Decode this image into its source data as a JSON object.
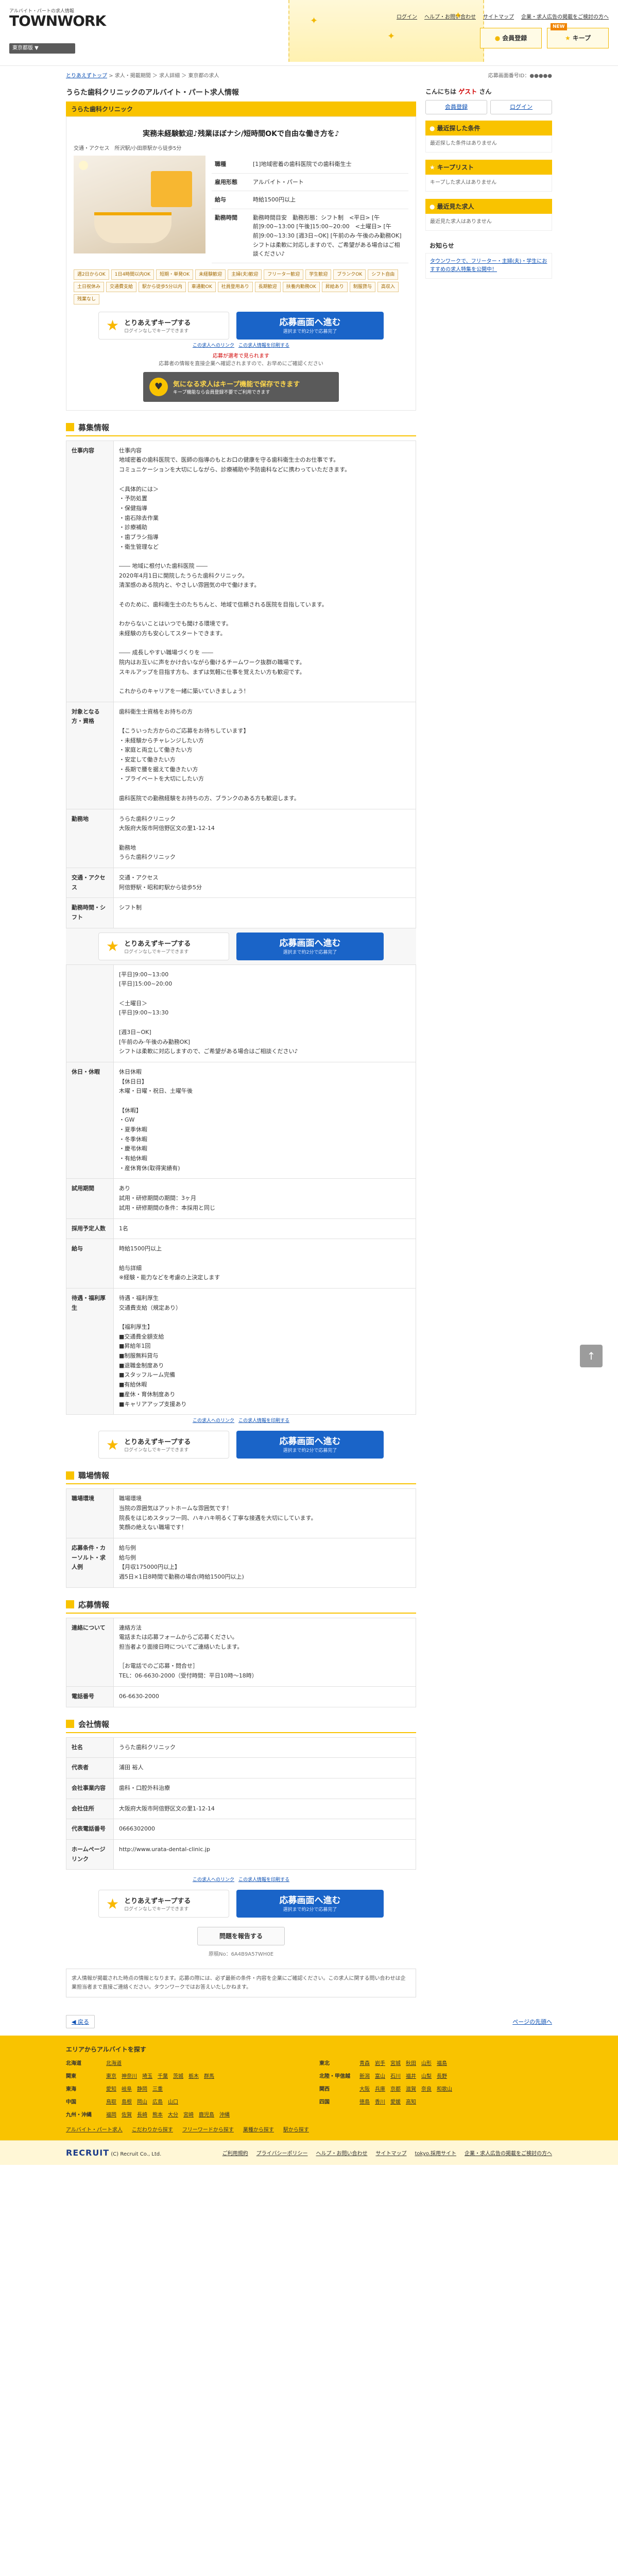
{
  "header": {
    "logo_small": "アルバイト・パートの求人情報",
    "logo_main": "TOWNWORK",
    "pref": "東京都版 ▼",
    "toplinks": [
      "ログイン",
      "ヘルプ・お問い合わせ",
      "サイトマップ",
      "企業・求人広告の掲載をご検討の方へ"
    ],
    "member_btn": "会員登録",
    "keep_btn": "キープ",
    "keep_tag": "NEW"
  },
  "breadcrumb": {
    "items": [
      "とりあえずトップ",
      "求人・掲載期間 ＞ 求人詳細 ＞ 東京都の求人"
    ],
    "right": "応募画面番号ID：●●●●●"
  },
  "job": {
    "company_title": "うらた歯科クリニックのアルバイト・パート求人情報",
    "company_bar": "うらた歯科クリニック",
    "catch": "実務未経験歓迎♪残業ほぼナシ/短時間OKで自由な働き方を♪",
    "tags_line": "交通・アクセス　所沢駅/小田原駅から徒歩5分",
    "info": [
      {
        "h": "職種",
        "v": "[1]地域密着の歯科医院での歯科衛生士"
      },
      {
        "h": "雇用形態",
        "v": "アルバイト・パート"
      },
      {
        "h": "給与",
        "v": "時給1500円以上"
      },
      {
        "h": "勤務時間",
        "v": "勤務時間目安　勤務形態：シフト制　<平日> [午前]9:00~13:00 [午後]15:00~20:00　<土曜日> [午前]9:00~13:30 [週3日~OK] [午前のみ·午後のみ勤務OK] シフトは柔軟に対応しますので、ご希望がある場合はご相談ください♪"
      }
    ],
    "chips": [
      "週2日からOK",
      "1日4時間以内OK",
      "短期・単発OK",
      "未経験歓迎",
      "主婦(夫)歓迎",
      "フリーター歓迎",
      "学生歓迎",
      "ブランクOK",
      "シフト自由",
      "土日祝休み",
      "交通費支給",
      "駅から徒歩5分以内",
      "車通勤OK",
      "社員登用あり",
      "長期歓迎",
      "扶養内勤務OK",
      "昇給あり",
      "制服貸与",
      "高収入",
      "残業なし"
    ]
  },
  "cta": {
    "keep_t1": "とりあえずキープする",
    "keep_t2": "ログインなしでキープできます",
    "apply_t1": "応募画面へ進む",
    "apply_t2": "選択まで約2分で応募完了",
    "links": [
      "この求人へのリンク",
      "この求人情報を印刷する"
    ],
    "note1": "応募が選考で見られます",
    "note2": "応募者の情報を直接企業へ確認されますので、お早めにご確認ください",
    "banner_t1": "気になる求人はキープ機能で保存できます",
    "banner_t2": "キープ機能なら会員登録不要でご利用できます"
  },
  "section_recruit": "募集情報",
  "recruit": [
    {
      "h": "仕事内容",
      "v": "仕事内容\n地域密着の歯科医院で、医師の指導のもとお口の健康を守る歯科衛生士のお仕事です。\nコミュニケーションを大切にしながら、診療補助や予防歯科などに携わっていただきます。\n\n＜具体的には＞\n・予防処置\n・保健指導\n・歯石除去作業\n・診療補助\n・歯ブラシ指導\n・衛生管理など\n\n―― 地域に根付いた歯科医院 ――\n2020年4月1日に開院したうらた歯科クリニック。\n清潔感のある院内と、やさしい雰囲気の中で働けます。\n\nそのために、歯科衛生士のたちちんと、地域で信頼される医院を目指しています。\n\nわからないことはいつでも聞ける環境です。\n未経験の方も安心してスタートできます。\n\n―― 成長しやすい職場づくりを ――\n院内はお互いに声をかけ合いながら働けるチームワーク抜群の職場です。\nスキルアップを目指す方も、まずは気軽に仕事を覚えたい方も歓迎です。\n\nこれからのキャリアを一緒に築いていきましょう！"
    },
    {
      "h": "対象となる方・資格",
      "v": "歯科衛生士資格をお持ちの方\n\n【こういった方からのご応募をお待ちしています】\n・未経験からチャレンジしたい方\n・家庭と両立して働きたい方\n・安定して働きたい方\n・長期で腰を据えて働きたい方\n・プライベートを大切にしたい方\n\n歯科医院での勤務経験をお持ちの方、ブランクのある方も歓迎します。"
    },
    {
      "h": "勤務地",
      "v": "うらた歯科クリニック\n大阪府大阪市阿倍野区文の里1-12-14\n\n勤務地\nうらた歯科クリニック"
    },
    {
      "h": "交通・アクセス",
      "v": "交通・アクセス\n阿倍野駅・昭和町駅から徒歩5分"
    },
    {
      "h": "勤務時間・シフト",
      "v": "シフト制"
    }
  ],
  "recruit2": [
    {
      "h": "",
      "v": "[平日]9:00~13:00\n[平日]15:00~20:00\n\n＜土曜日＞\n[平日]9:00~13:30\n\n[週3日~OK]\n[午前のみ·午後のみ勤務OK]\nシフトは柔軟に対応しますので、ご希望がある場合はご相談ください♪"
    },
    {
      "h": "休日・休暇",
      "v": "休日休暇\n【休日日】\n木曜・日曜・祝日、土曜午後\n\n【休暇】\n・GW\n・夏季休暇\n・冬季休暇\n・慶弔休暇\n・有給休暇\n・産休育休(取得実績有)"
    },
    {
      "h": "試用期間",
      "v": "あり\n試用・研修期間の期間：3ヶ月\n試用・研修期間の条件：本採用と同じ"
    },
    {
      "h": "採用予定人数",
      "v": "1名"
    },
    {
      "h": "給与",
      "v": "時給1500円以上\n\n給与詳細\n※経験・能力などを考慮の上決定します"
    },
    {
      "h": "待遇・福利厚生",
      "v": "待遇・福利厚生\n交通費支給（規定あり）\n\n【福利厚生】\n■交通費全額支給\n■昇給年1回\n■制服無料貸与\n■退職金制度あり\n■スタッフルーム完備\n■有給休暇\n■産休・育休制度あり\n■キャリアアップ支援あり"
    }
  ],
  "section_workplace": "職場情報",
  "workplace": [
    {
      "h": "職場環境",
      "v": "職場環境\n当院の雰囲気はアットホームな雰囲気です！\n院長をはじめスタッフ一同、ハキハキ明るく丁寧な接遇を大切にしています。\n笑顔の絶えない職場です！"
    },
    {
      "h": "応募条件・カーソルト・求人例",
      "v": "給与例\n給与例\n【月収175000円以上】\n週5日×1日8時間で勤務の場合(時給1500円以上)"
    }
  ],
  "section_apply": "応募情報",
  "apply": [
    {
      "h": "連絡について",
      "v": "連絡方法\n電話または応募フォームからご応募ください。\n担当者より面接日時についてご連絡いたします。\n\n［お電話でのご応募・問合せ］\nTEL：06-6630-2000（受付時間：平日10時～18時）"
    },
    {
      "h": "電話番号",
      "v": "06-6630-2000"
    }
  ],
  "section_company": "会社情報",
  "company": [
    {
      "h": "社名",
      "v": "うらた歯科クリニック"
    },
    {
      "h": "代表者",
      "v": "浦田 裕人"
    },
    {
      "h": "会社事業内容",
      "v": "歯科・口腔外科治療"
    },
    {
      "h": "会社住所",
      "v": "大阪府大阪市阿倍野区文の里1-12-14"
    },
    {
      "h": "代表電話番号",
      "v": "0666302000"
    },
    {
      "h": "ホームページリンク",
      "v": "http://www.urata-dental-clinic.jp"
    }
  ],
  "footer_main": {
    "print": "問題を報告する",
    "job_no": "原稿No：6A4B9A57WH0E",
    "notice": "求人情報が掲載された時点の情報となります。応募の際には、必ず最新の条件・内容を企業にご確認ください。この求人に関する問い合わせは企業担当者まで直接ご連絡ください。タウンワークではお答えいたしかねます。"
  },
  "side": {
    "hello_prefix": "こんにちは",
    "hello_name": "ゲスト",
    "hello_suffix": "さん",
    "btn_register": "会員登録",
    "btn_login": "ログイン",
    "recent_search": "最近探した条件",
    "recent_search_body": "最近探した条件はありません",
    "keep_list": "キープリスト",
    "keep_list_body": "キープした求人はありません",
    "recent_view": "最近見た求人",
    "recent_view_body": "最近見た求人はありません",
    "news": "お知らせ",
    "news_body": "タウンワークで、フリーター・主婦(夫)・学生におすすめの求人特集を公開中！"
  },
  "bottom": {
    "back": "戻る",
    "pagetop": "ページの先頭へ",
    "footer_heading": "エリアからアルバイトを探す",
    "areas": [
      {
        "region": "北海道",
        "prefs": [
          "北海道"
        ]
      },
      {
        "region": "東北",
        "prefs": [
          "青森",
          "岩手",
          "宮城",
          "秋田",
          "山形",
          "福島"
        ]
      },
      {
        "region": "関東",
        "prefs": [
          "東京",
          "神奈川",
          "埼玉",
          "千葉",
          "茨城",
          "栃木",
          "群馬"
        ]
      },
      {
        "region": "北陸・甲信越",
        "prefs": [
          "新潟",
          "富山",
          "石川",
          "福井",
          "山梨",
          "長野"
        ]
      },
      {
        "region": "東海",
        "prefs": [
          "愛知",
          "岐阜",
          "静岡",
          "三重"
        ]
      },
      {
        "region": "関西",
        "prefs": [
          "大阪",
          "兵庫",
          "京都",
          "滋賀",
          "奈良",
          "和歌山"
        ]
      },
      {
        "region": "中国",
        "prefs": [
          "鳥取",
          "島根",
          "岡山",
          "広島",
          "山口"
        ]
      },
      {
        "region": "四国",
        "prefs": [
          "徳島",
          "香川",
          "愛媛",
          "高知"
        ]
      },
      {
        "region": "九州・沖縄",
        "prefs": [
          "福岡",
          "佐賀",
          "長崎",
          "熊本",
          "大分",
          "宮崎",
          "鹿児島",
          "沖縄"
        ]
      }
    ],
    "footer_links": [
      "アルバイト・パート求人",
      "こだわりから探す",
      "フリーワードから探す",
      "業種から探す",
      "駅から探す"
    ],
    "recruit": "RECRUIT",
    "copyright": "(C) Recruit Co., Ltd.",
    "legal_links": [
      "ご利用規約",
      "プライバシーポリシー",
      "ヘルプ・お問い合わせ",
      "サイトマップ",
      "tokyo.採用サイト",
      "企業・求人広告の掲載をご検討の方へ"
    ]
  },
  "colors": {
    "accent": "#f9c300",
    "apply": "#1a64c8",
    "link": "#0b4fb3"
  }
}
